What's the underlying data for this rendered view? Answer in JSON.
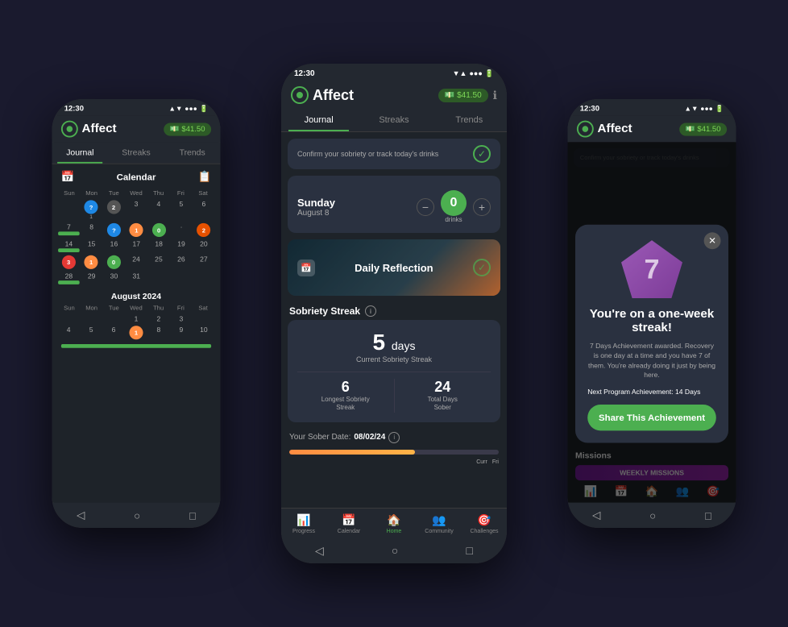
{
  "app": {
    "name": "Affect",
    "wallet_amount": "$41.50",
    "time_left": "12:30",
    "time_center": "12:30",
    "time_right": "12:30"
  },
  "tabs": {
    "journal": "Journal",
    "streaks": "Streaks",
    "trends": "Trends"
  },
  "center_phone": {
    "confirm_text": "Confirm your sobriety or track today's drinks",
    "day": "Sunday",
    "date": "August 8",
    "drinks_count": "0",
    "drinks_label": "drinks",
    "reflection_title": "Daily Reflection",
    "sobriety_streak_label": "Sobriety Streak",
    "streak_days": "5 days",
    "streak_sublabel": "Current Sobriety Streak",
    "longest_number": "6",
    "longest_label": "Longest Sobriety\nStreak",
    "total_number": "24",
    "total_label": "Total Days\nSober",
    "sober_date_label": "Your Sober Date:",
    "sober_date_value": "08/02/24"
  },
  "nav": {
    "items": [
      {
        "label": "Progress",
        "icon": "📊",
        "active": false
      },
      {
        "label": "Calendar",
        "icon": "📅",
        "active": false
      },
      {
        "label": "Home",
        "icon": "🏠",
        "active": true
      },
      {
        "label": "Community",
        "icon": "👥",
        "active": false
      },
      {
        "label": "Challenges",
        "icon": "🎯",
        "active": false
      }
    ]
  },
  "left_phone": {
    "calendar_title": "Calendar",
    "month1": "August 2024",
    "days_header": [
      "Sun",
      "Mon",
      "Tue",
      "Wed",
      "Thu",
      "Fri",
      "Sat"
    ]
  },
  "right_phone": {
    "modal": {
      "title": "You're on a one-week streak!",
      "badge_number": "7",
      "description": "7 Days Achievement awarded. Recovery is one day at a time and you have 7 of them. You're already doing it just by being here.",
      "next_label": "Next Program Achievement: 14 Days",
      "share_btn": "Share This Achievement"
    },
    "missions_label": "Missions",
    "missions_bar": "WEEKLY MISSIONS"
  }
}
